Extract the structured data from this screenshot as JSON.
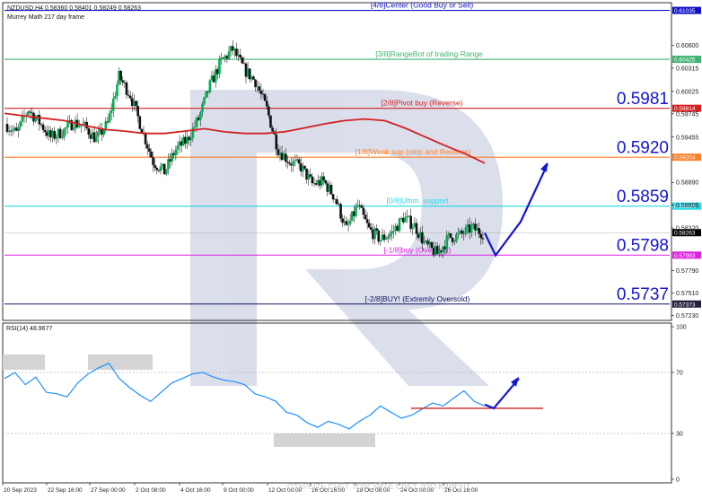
{
  "header": {
    "symbol_line": "NZDUSD,H4  0.58360 0.58401 0.58249 0.58263",
    "subtitle": "Murrey Math 217 day frame"
  },
  "price_axis": {
    "ticks": [
      "0.60600",
      "0.60315",
      "0.60025",
      "0.59745",
      "0.59455",
      "0.58890",
      "0.58605",
      "0.58320",
      "0.57790",
      "0.57510",
      "0.57230"
    ],
    "tick_values": [
      0.606,
      0.60315,
      0.60025,
      0.59745,
      0.59455,
      0.5889,
      0.58605,
      0.5832,
      0.5779,
      0.5751,
      0.5723
    ]
  },
  "levels": [
    {
      "label": "[4/8]Center (Good Buy or Sell)",
      "tag": "0.61035",
      "value": 0.61035,
      "color": "#1010c8",
      "tag_color": "#1010c8"
    },
    {
      "label": "[3/8]RangeBot of trading Range",
      "tag": "0.60425",
      "value": 0.60425,
      "color": "#3cb371",
      "tag_color": "#3cb371"
    },
    {
      "label": "[2/8]Pivot buy (Reverse)",
      "tag": "0.59814",
      "value": 0.59814,
      "color": "#d42020",
      "tag_color": "#d42020"
    },
    {
      "label": "[1/8]Weak sup (stop and Reverse)",
      "tag": "0.59204",
      "value": 0.59204,
      "color": "#ff7f27",
      "tag_color": "#ff7f27"
    },
    {
      "label": "[0/8]Ultim. support",
      "tag": "0.58594",
      "value": 0.58594,
      "color": "#20d8e8",
      "tag_color": "#20d8e8"
    },
    {
      "label": "[-1/8]buy (Oversold)",
      "tag": "0.57983",
      "value": 0.57983,
      "color": "#e020e0",
      "tag_color": "#e020e0"
    },
    {
      "label": "[-2/8]BUY! (Extremly Oversold)",
      "tag": "0.57373",
      "value": 0.57373,
      "color": "#101060",
      "tag_color": "#202040"
    }
  ],
  "current_price": {
    "tag": "0.58263",
    "value": 0.58263
  },
  "big_labels": [
    {
      "text": "0.5981",
      "value": 0.5981
    },
    {
      "text": "0.5920",
      "value": 0.592
    },
    {
      "text": "0.5859",
      "value": 0.5859
    },
    {
      "text": "0.5798",
      "value": 0.5798
    },
    {
      "text": "0.5737",
      "value": 0.5737
    }
  ],
  "rsi": {
    "label": "RSI(14) 48.9677",
    "ticks": [
      "100",
      "70",
      "30",
      "0"
    ],
    "tick_values": [
      100,
      70,
      30,
      0
    ],
    "overbought": 70,
    "oversold": 30,
    "support_level": 46.5
  },
  "time_axis": [
    "20 Sep 2023",
    "22 Sep 16:00",
    "27 Sep 00:00",
    "2 Oct 08:00",
    "4 Oct 16:00",
    "9 Oct 00:00",
    "12 Oct 00:00",
    "16 Oct 16:00",
    "19 Oct 08:00",
    "24 Oct 00:00",
    "26 Oct 16:00"
  ],
  "watermark": "ОТКРЫТЬ СЧЁТ  ТОРГУЙТЕ СВЕТ ЭТО КЛИЕНТ",
  "chart_data": [
    {
      "type": "line",
      "title": "NZDUSD,H4",
      "subtitle": "Murrey Math 217 day frame",
      "x_categories": [
        "20 Sep 2023",
        "22 Sep 16:00",
        "27 Sep 00:00",
        "2 Oct 08:00",
        "4 Oct 16:00",
        "9 Oct 00:00",
        "12 Oct 00:00",
        "16 Oct 16:00",
        "19 Oct 08:00",
        "24 Oct 00:00",
        "26 Oct 16:00"
      ],
      "series": [
        {
          "values": [
            0.5962,
            0.595,
            0.598,
            0.5964,
            0.5945,
            0.5952,
            0.5964,
            0.5958,
            0.5943,
            0.5962,
            0.6021,
            0.5998,
            0.5956,
            0.5915,
            0.5902,
            0.593,
            0.5942,
            0.5968,
            0.601,
            0.604,
            0.6055,
            0.603,
            0.6015,
            0.598,
            0.593,
            0.5915,
            0.5908,
            0.5887,
            0.589,
            0.587,
            0.583,
            0.586,
            0.583,
            0.5818,
            0.5826,
            0.5845,
            0.5835,
            0.581,
            0.58,
            0.582,
            0.5823,
            0.5832,
            0.5826
          ]
        },
        {
          "name": "MA",
          "values": [
            0.5975,
            0.5972,
            0.5969,
            0.5966,
            0.596,
            0.5955,
            0.5953,
            0.595,
            0.595,
            0.5953,
            0.5956,
            0.5952,
            0.595,
            0.595,
            0.5952,
            0.5957,
            0.5962,
            0.5966,
            0.5968,
            0.5966,
            0.5957,
            0.5946,
            0.5935,
            0.5925,
            0.5913
          ]
        }
      ],
      "forecast_arrow": [
        0.5826,
        0.5798,
        0.584,
        0.5912
      ],
      "ylim": [
        0.5718,
        0.6112
      ],
      "grid": false
    },
    {
      "type": "line",
      "title": "RSI(14) 48.9677",
      "series": [
        {
          "values": [
            66,
            70,
            62,
            67,
            57,
            56,
            54,
            63,
            69,
            73,
            76,
            66,
            60,
            55,
            51,
            57,
            63,
            66,
            69,
            70,
            67,
            65,
            64,
            62,
            56,
            54,
            51,
            44,
            42,
            37,
            34,
            38,
            36,
            33,
            38,
            42,
            48,
            44,
            40,
            42,
            46,
            50,
            48,
            53,
            58,
            51,
            48
          ]
        }
      ],
      "ylim": [
        0,
        100
      ],
      "hlines": [
        70,
        30,
        46.5
      ],
      "forecast_arrow": [
        48.97,
        46.5,
        66
      ]
    }
  ]
}
